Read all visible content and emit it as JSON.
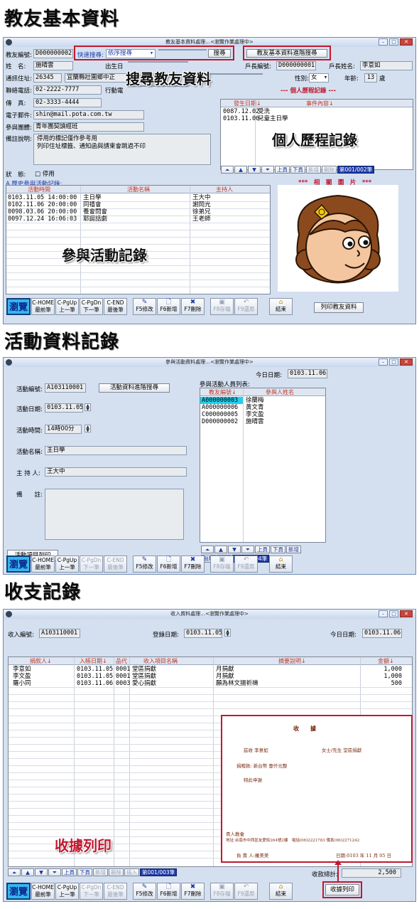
{
  "headings": {
    "teacher": "教友基本資料",
    "activity": "活動資料記錄",
    "finance": "收支記錄"
  },
  "overlays": {
    "search": "搜尋教友資料",
    "history": "個人歷程記錄",
    "participation": "參與活動記錄",
    "receipt_print": "收據列印"
  },
  "win1": {
    "title": "教友基本資料處理…<瀏覽作業處理中>",
    "member_id_label": "教友編號:",
    "member_id": "D000000002",
    "quick_search_label": "快速搜尋:",
    "quick_search_mode": "依序搜尋",
    "search_btn": "搜尋",
    "advanced_btn": "教友基本資料進階搜尋",
    "name_label": "姓　名:",
    "name": "施晴雲",
    "birth_label": "出生日",
    "household_id_label": "戶長編號:",
    "household_id": "D000000001",
    "household_name_label": "戶長姓名:",
    "household_name": "李意如",
    "address_label": "通訊住址:",
    "zip": "26345",
    "address": "宜蘭縣壯圍鄉中正",
    "gender_label": "性別:",
    "gender": "女",
    "age_label": "年齡:",
    "age": "13",
    "age_unit": "歲",
    "phone_label": "聯絡電話:",
    "phone": "02-2222-7777",
    "mobile_label": "行動電",
    "fax_label": "傳　真:",
    "fax": "02-3333-4444",
    "email_label": "電子郵件:",
    "email": "shin@mail.pota.com.tw",
    "group_label": "參與團體:",
    "group": "青年團契讀經班",
    "remark_label": "備註說明:",
    "remark_line1": "停用的標記僅作參考用",
    "remark_line2": "列印住址標籤、通知函與請柬會跳過不印",
    "status_label": "狀　態:",
    "status_value": "停用",
    "history_header": "--- 個人歷程記錄 ---",
    "history_cols": [
      "發生日期↓",
      "事件內容↓"
    ],
    "history_rows": [
      {
        "date": "0087.12.02",
        "event": "受洗"
      },
      {
        "date": "0103.11.06",
        "event": "兒童主日學"
      }
    ],
    "history_nav": {
      "prev": "上頁",
      "next": "下頁",
      "add": "新增",
      "del": "刪除",
      "page": "第001/002筆"
    },
    "photo_label": "***　相　關　圖　片　***",
    "activity_section": "A.歷史參與活動記錄:",
    "activity_cols": [
      "活動時間",
      "活動名稱",
      "主持人"
    ],
    "activity_rows": [
      {
        "time": "0103.11.05 14:00:00",
        "name": "主日學",
        "host": "王大中"
      },
      {
        "time": "0102.11.06 20:00:00",
        "name": "同禧會",
        "host": "謝岡光"
      },
      {
        "time": "0098.03.06 20:00:00",
        "name": "養會問會",
        "host": "徐弟兄"
      },
      {
        "time": "0097.12.24 16:06:03",
        "name": "耶誕話劇",
        "host": "王老師"
      }
    ],
    "print_btn": "列印教友資料"
  },
  "toolbar": {
    "browse": "瀏覽",
    "home": "C-HOME 最前筆",
    "pgup": "C-PgUp 上一筆",
    "pgdn": "C-PgDn 下一筆",
    "end": "C-END 最後筆",
    "edit": "F5修改",
    "add": "F6新增",
    "del": "F7刪除",
    "save": "F8存檔",
    "restore": "F9還原",
    "close": "結束"
  },
  "win2": {
    "title": "參與活動資料處理…<瀏覽作業處理中>",
    "today_label": "今日日期:",
    "today": "0103.11.06",
    "id_label": "活動編號:",
    "id": "A103110001",
    "advanced_btn": "活動資料進階搜尋",
    "participants_label": "參與活動人員列表:",
    "participant_cols": [
      "教友編號↓",
      "參與人姓名"
    ],
    "participants": [
      {
        "id": "A000000003",
        "name": "徐蘭梅"
      },
      {
        "id": "A000000006",
        "name": "黃文青"
      },
      {
        "id": "C000000005",
        "name": "李文盈"
      },
      {
        "id": "D000000002",
        "name": "施晴雲"
      }
    ],
    "date_label": "活動日期:",
    "date": "0103.11.05",
    "time_label": "活動時間:",
    "time": "14時00分",
    "name_label": "活動名稱:",
    "name": "主日學",
    "host_label": "主 持 人:",
    "host": "王大中",
    "remark_label": "備　　註:",
    "print_btn": "活動項目列印",
    "nav": {
      "prev": "上頁",
      "next": "下頁",
      "add": "新增",
      "del": "刪除",
      "insert": "插入",
      "page": "第001/004筆"
    }
  },
  "win3": {
    "title": "收入資料處理…<瀏覽作業處理中>",
    "id_label": "收入編號:",
    "id": "A103110001",
    "reg_label": "登錄日期:",
    "reg_date": "0103.11.05",
    "today_label": "今日日期:",
    "today": "0103.11.06",
    "cols": [
      "捐款人↓",
      "入帳日期↓",
      "品代",
      "收入項目名稱",
      "摘要說明↓",
      "金額↓"
    ],
    "rows": [
      {
        "donor": "李意如",
        "date": "0103.11.05",
        "code": "0001",
        "item": "堂區捐獻",
        "memo": "月捐獻",
        "amount": "1,000"
      },
      {
        "donor": "李文盈",
        "date": "0103.11.05",
        "code": "0001",
        "item": "堂區捐獻",
        "memo": "月捐獻",
        "amount": "1,000"
      },
      {
        "donor": "羅小同",
        "date": "0103.11.06",
        "code": "0003",
        "item": "愛心捐獻",
        "memo": "願為林文揚祈禱",
        "amount": "500"
      }
    ],
    "total_label": "收款總計:",
    "total": "2,500",
    "receipt_btn": "收據列印",
    "nav": {
      "prev": "上頁",
      "next": "下頁",
      "add": "新增",
      "del": "刪除",
      "insert": "插入",
      "page": "第001/003筆"
    },
    "receipt": {
      "title": "收　　據",
      "line1": "茲收 李意如",
      "line1b": "女士/先生 堂區捐獻",
      "line2": "捐贈款: 新台幣 壹仟元整",
      "line3": "特此申謝",
      "org": "貴人教會",
      "addr": "地址:台南市中西區友愛街264號2樓　電話(06)2221783 傳真(06)2271242",
      "sign": "負 責 人:羅美美",
      "date": "日期:0103 年 11 月 05 日"
    }
  }
}
